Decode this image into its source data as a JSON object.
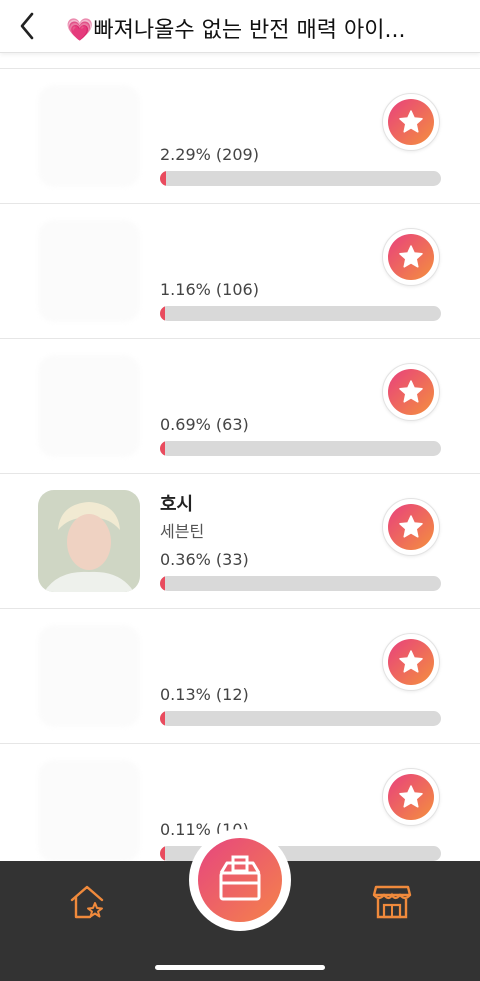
{
  "header": {
    "title": "💗빠져나올수 없는 반전 매력 아이...",
    "back_icon": "chevron-left-icon"
  },
  "rows": [
    {
      "name": "",
      "group": "",
      "percent_text": "2.29% (209)",
      "percent": 2.29,
      "visible_thumb": false
    },
    {
      "name": "",
      "group": "",
      "percent_text": "1.16% (106)",
      "percent": 1.16,
      "visible_thumb": false
    },
    {
      "name": "",
      "group": "",
      "percent_text": "0.69% (63)",
      "percent": 0.69,
      "visible_thumb": false
    },
    {
      "name": "호시",
      "group": "세븐틴",
      "percent_text": "0.36% (33)",
      "percent": 0.36,
      "visible_thumb": true
    },
    {
      "name": "",
      "group": "",
      "percent_text": "0.13% (12)",
      "percent": 0.13,
      "visible_thumb": false
    },
    {
      "name": "",
      "group": "",
      "percent_text": "0.11% (10)",
      "percent": 0.11,
      "visible_thumb": false
    }
  ],
  "colors": {
    "accent_start": "#e8407d",
    "accent_end": "#f4903e",
    "bar_fill": "#e94b5e",
    "bar_track": "#d9d9d9",
    "bottom_bar": "#333333",
    "nav_icon": "#f08a3c"
  },
  "bottom_nav": {
    "home_icon": "home-star-icon",
    "center_icon": "ballot-box-icon",
    "store_icon": "store-icon"
  }
}
